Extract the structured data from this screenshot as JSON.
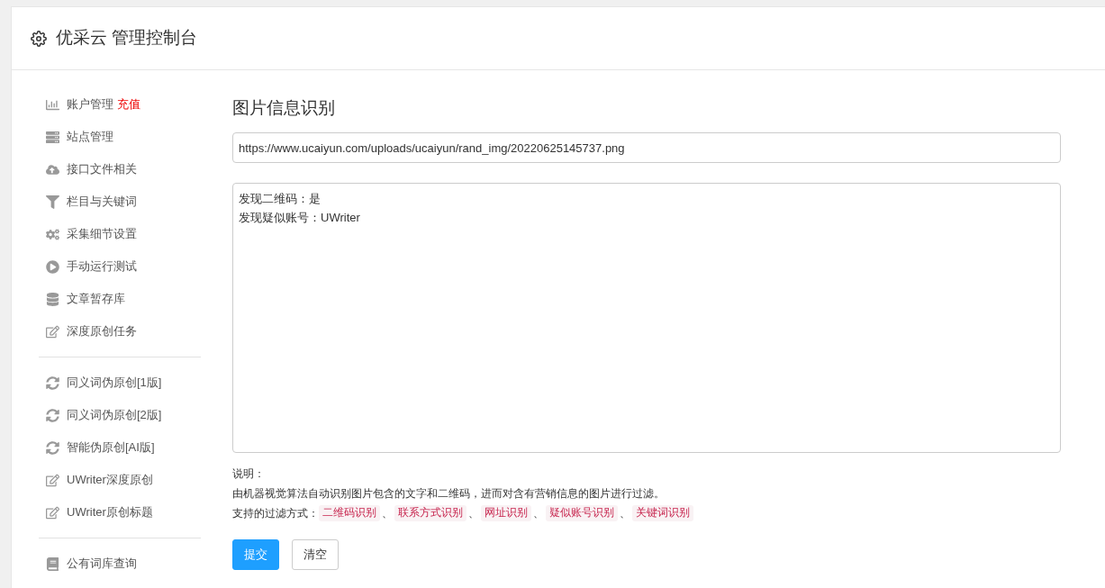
{
  "header": {
    "title": "优采云 管理控制台"
  },
  "sidebar": {
    "groups": [
      [
        {
          "label": "账户管理",
          "badge": "充值",
          "kind": "chart"
        },
        {
          "label": "站点管理",
          "kind": "server"
        },
        {
          "label": "接口文件相关",
          "kind": "cloud"
        },
        {
          "label": "栏目与关键词",
          "kind": "filter"
        },
        {
          "label": "采集细节设置",
          "kind": "gears"
        },
        {
          "label": "手动运行测试",
          "kind": "play"
        },
        {
          "label": "文章暂存库",
          "kind": "database"
        },
        {
          "label": "深度原创任务",
          "kind": "edit"
        }
      ],
      [
        {
          "label": "同义词伪原创[1版]",
          "kind": "sync"
        },
        {
          "label": "同义词伪原创[2版]",
          "kind": "sync"
        },
        {
          "label": "智能伪原创[AI版]",
          "kind": "sync"
        },
        {
          "label": "UWriter深度原创",
          "kind": "edit"
        },
        {
          "label": "UWriter原创标题",
          "kind": "edit"
        }
      ],
      [
        {
          "label": "公有词库查询",
          "kind": "book"
        }
      ]
    ]
  },
  "main": {
    "title": "图片信息识别",
    "url_field": {
      "value": "https://www.ucaiyun.com/uploads/ucaiyun/rand_img/20220625145737.png"
    },
    "result_box": {
      "lines": [
        "发现二维码：是",
        "发现疑似账号：UWriter"
      ]
    },
    "notes": {
      "heading": "说明：",
      "description": "由机器视觉算法自动识别图片包含的文字和二维码，进而对含有营销信息的图片进行过滤。",
      "methods_label": "支持的过滤方式：",
      "separator": "、",
      "methods": [
        "二维码识别",
        "联系方式识别",
        "网址识别",
        "疑似账号识别",
        "关键词识别"
      ]
    },
    "buttons": [
      {
        "label": "提交",
        "kind": "primary"
      },
      {
        "label": "清空",
        "kind": "default"
      }
    ]
  }
}
